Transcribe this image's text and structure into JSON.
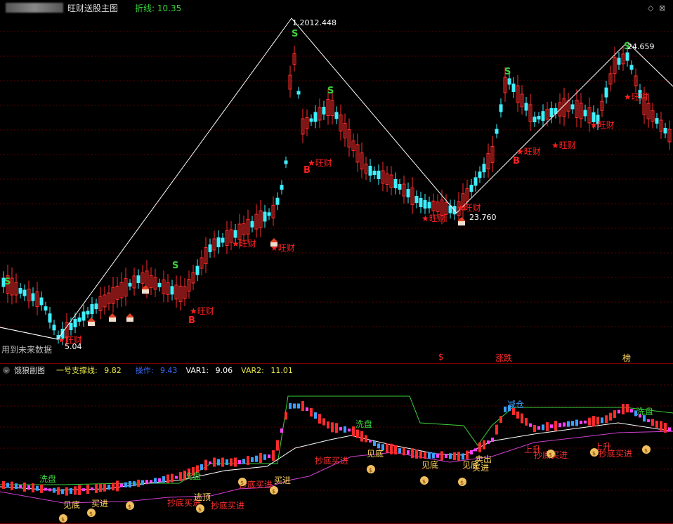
{
  "main": {
    "title": "旺财送股主图",
    "zigzag_label": "折线:",
    "zigzag_value": "10.35",
    "peak_high": "12.448",
    "peak_high_prefix": "1.20",
    "peak_right": "24.659",
    "low_mid": "23.760",
    "low_left": "5.04",
    "future_data_label": "用到未来数据",
    "signal_wangcai": "旺财",
    "signal_b": "B",
    "signal_s": "S",
    "bottom_markers": [
      "$",
      "涨跌",
      "榜"
    ]
  },
  "sub": {
    "title": "饿狼副图",
    "support_label": "一号支撑线:",
    "support_value": "9.82",
    "op_label": "操作:",
    "op_value": "9.43",
    "var1_label": "VAR1:",
    "var1_value": "9.06",
    "var2_label": "VAR2:",
    "var2_value": "11.01",
    "tags": [
      "洗盘",
      "见底",
      "买进",
      "抄底买进",
      "逃顶",
      "卖出",
      "减仓",
      "上升"
    ]
  },
  "colors": {
    "up": "#ff2b2b",
    "down": "#3ff0ff",
    "zigzag": "#ffffff",
    "signal_red": "#ff2020",
    "signal_green": "#3ad13a",
    "support": "#3ad13a",
    "magenta": "#d040d0"
  },
  "window_controls": [
    "restore-icon",
    "close-icon"
  ]
}
